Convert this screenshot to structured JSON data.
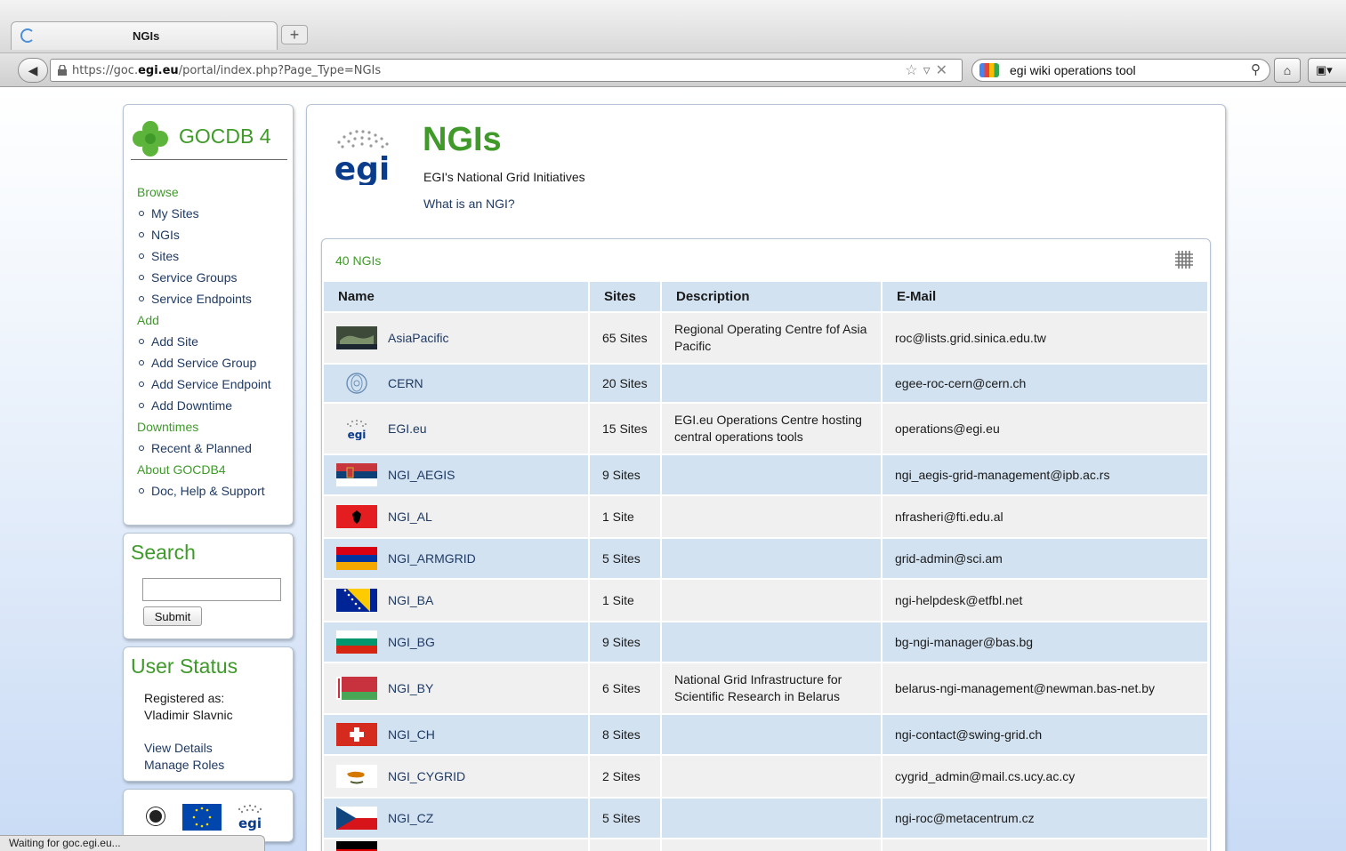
{
  "browser": {
    "tab_title": "NGIs",
    "url_prefix": "https://goc.",
    "url_domain": "egi.eu",
    "url_suffix": "/portal/index.php?Page_Type=NGIs",
    "search_query": "egi wiki operations tool",
    "status": "Waiting for goc.egi.eu..."
  },
  "sidebar": {
    "logo_text": "GOCDB 4",
    "sections": [
      {
        "heading": "Browse",
        "items": [
          "My Sites",
          "NGIs",
          "Sites",
          "Service Groups",
          "Service Endpoints"
        ]
      },
      {
        "heading": "Add",
        "items": [
          "Add Site",
          "Add Service Group",
          "Add Service Endpoint",
          "Add Downtime"
        ]
      },
      {
        "heading": "Downtimes",
        "items": [
          "Recent & Planned"
        ]
      },
      {
        "heading": "About GOCDB4",
        "items": [
          "Doc, Help & Support"
        ]
      }
    ]
  },
  "search": {
    "title": "Search",
    "value": "",
    "submit_label": "Submit"
  },
  "user_status": {
    "title": "User Status",
    "registered_label": "Registered as:",
    "user_name": "Vladimir Slavnic",
    "view_details": "View Details",
    "manage_roles": "Manage Roles"
  },
  "main": {
    "title": "NGIs",
    "subtitle": "EGI's National Grid Initiatives",
    "link": "What is an NGI?",
    "logo_text": "egi",
    "count": "40 NGIs"
  },
  "table": {
    "headers": [
      "Name",
      "Sites",
      "Description",
      "E-Mail"
    ],
    "rows": [
      {
        "name": "AsiaPacific",
        "sites": "65 Sites",
        "description": "Regional Operating Centre fof Asia Pacific",
        "email": "roc@lists.grid.sinica.edu.tw",
        "flag": "asiapacific-flag-icon"
      },
      {
        "name": "CERN",
        "sites": "20 Sites",
        "description": "",
        "email": "egee-roc-cern@cern.ch",
        "flag": "cern-logo-icon"
      },
      {
        "name": "EGI.eu",
        "sites": "15 Sites",
        "description": "EGI.eu Operations Centre hosting central operations tools",
        "email": "operations@egi.eu",
        "flag": "egi-logo-icon"
      },
      {
        "name": "NGI_AEGIS",
        "sites": "9 Sites",
        "description": "",
        "email": "ngi_aegis-grid-management@ipb.ac.rs",
        "flag": "serbia-flag-icon"
      },
      {
        "name": "NGI_AL",
        "sites": "1 Site",
        "description": "",
        "email": "nfrasheri@fti.edu.al",
        "flag": "albania-flag-icon"
      },
      {
        "name": "NGI_ARMGRID",
        "sites": "5 Sites",
        "description": "",
        "email": "grid-admin@sci.am",
        "flag": "armenia-flag-icon"
      },
      {
        "name": "NGI_BA",
        "sites": "1 Site",
        "description": "",
        "email": "ngi-helpdesk@etfbl.net",
        "flag": "bosnia-flag-icon"
      },
      {
        "name": "NGI_BG",
        "sites": "9 Sites",
        "description": "",
        "email": "bg-ngi-manager@bas.bg",
        "flag": "bulgaria-flag-icon"
      },
      {
        "name": "NGI_BY",
        "sites": "6 Sites",
        "description": "National Grid Infrastructure for Scientific Research in Belarus",
        "email": "belarus-ngi-management@newman.bas-net.by",
        "flag": "belarus-flag-icon"
      },
      {
        "name": "NGI_CH",
        "sites": "8 Sites",
        "description": "",
        "email": "ngi-contact@swing-grid.ch",
        "flag": "switzerland-flag-icon"
      },
      {
        "name": "NGI_CYGRID",
        "sites": "2 Sites",
        "description": "",
        "email": "cygrid_admin@mail.cs.ucy.ac.cy",
        "flag": "cyprus-flag-icon"
      },
      {
        "name": "NGI_CZ",
        "sites": "5 Sites",
        "description": "",
        "email": "ngi-roc@metacentrum.cz",
        "flag": "czech-flag-icon"
      },
      {
        "name": "",
        "sites": "",
        "description": "",
        "email": "",
        "flag": "germany-flag-icon"
      }
    ]
  },
  "colors": {
    "accent_green": "#3f9a2a",
    "link_blue": "#1f3a63",
    "row_blue": "#d2e2f1",
    "row_gray": "#f0f0f0"
  }
}
